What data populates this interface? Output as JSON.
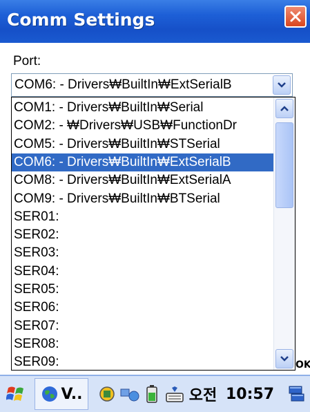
{
  "window": {
    "title": "Comm Settings",
    "close_icon": "close-icon"
  },
  "port": {
    "label": "Port:",
    "selected_value": "COM6: - Drivers₩BuiltIn₩ExtSerialB"
  },
  "list_items": [
    "COM1: - Drivers₩BuiltIn₩Serial",
    "COM2: - ₩Drivers₩USB₩FunctionDr",
    "COM5: - Drivers₩BuiltIn₩STSerial",
    "COM6: - Drivers₩BuiltIn₩ExtSerialB",
    "COM8: - Drivers₩BuiltIn₩ExtSerialA",
    "COM9: - Drivers₩BuiltIn₩BTSerial",
    "SER01:",
    "SER02:",
    "SER03:",
    "SER04:",
    "SER05:",
    "SER06:",
    "SER07:",
    "SER08:",
    "SER09:"
  ],
  "selected_index": 3,
  "behind_text": "OK",
  "taskbar": {
    "app_label": "V..",
    "ime_label": "오전",
    "time": "10:57"
  },
  "colors": {
    "title_bar": "#1d5fd6",
    "selection": "#316ac5",
    "close_button": "#d9461f",
    "taskbar": "#d6e3f8"
  }
}
